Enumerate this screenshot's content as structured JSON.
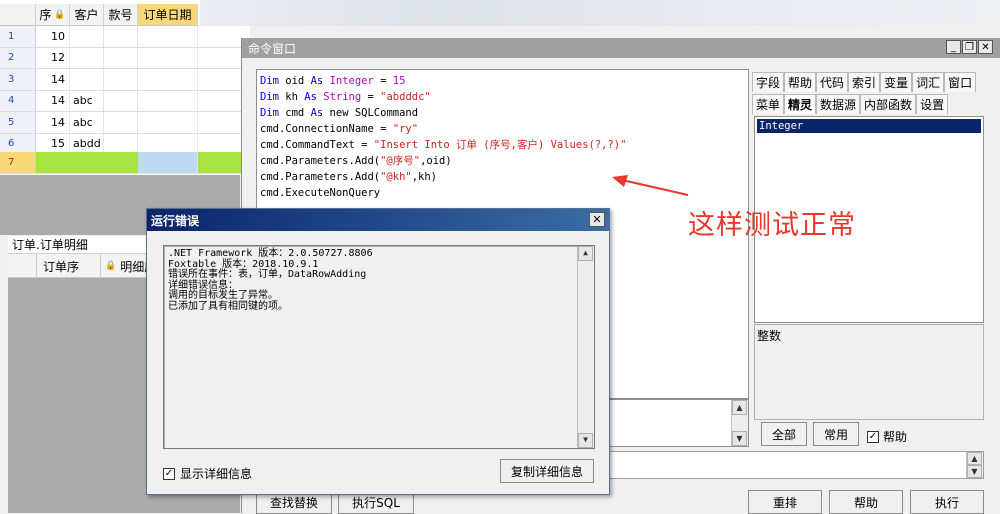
{
  "grid": {
    "columns": [
      "序",
      "客户",
      "款号",
      "订单日期"
    ],
    "rows": [
      {
        "num": "1",
        "seq": "10",
        "cust": ""
      },
      {
        "num": "2",
        "seq": "12",
        "cust": ""
      },
      {
        "num": "3",
        "seq": "14",
        "cust": ""
      },
      {
        "num": "4",
        "seq": "14",
        "cust": "abc"
      },
      {
        "num": "5",
        "seq": "14",
        "cust": "abc"
      },
      {
        "num": "6",
        "seq": "15",
        "cust": "abdd"
      },
      {
        "num": "7",
        "seq": "",
        "cust": ""
      }
    ]
  },
  "detail": {
    "title": "订单.订单明细",
    "columns": [
      "订单序",
      "明细序"
    ]
  },
  "command_window": {
    "title": "命令窗口",
    "code_lines": [
      "Dim oid As Integer = 15",
      "Dim kh As String = \"abdddc\"",
      "Dim cmd As new SQLCommand",
      "cmd.ConnectionName = \"ry\"",
      "cmd.CommandText = \"Insert Into 订单 (序号,客户) Values(?,?)\"",
      "cmd.Parameters.Add(\"@序号\",oid)",
      "cmd.Parameters.Add(\"@kh\",kh)",
      "cmd.ExecuteNonQuery"
    ],
    "tabs_row1": [
      "字段",
      "帮助",
      "代码",
      "索引",
      "变量",
      "词汇",
      "窗口"
    ],
    "tabs_row2": [
      "菜单",
      "精灵",
      "数据源",
      "内部函数",
      "设置"
    ],
    "list_selected": "Integer",
    "description": "整数",
    "btn_all": "全部",
    "btn_common": "常用",
    "chk_help": "帮助",
    "bottom_buttons": [
      "查找替换",
      "执行SQL",
      "重排",
      "帮助",
      "执行"
    ]
  },
  "annotation": "这样测试正常",
  "error_dialog": {
    "title": "运行错误",
    "lines": [
      ".NET Framework 版本：2.0.50727.8806",
      "Foxtable 版本：2018.10.9.1",
      "错误所在事件：表，订单，DataRowAdding",
      "详细错误信息：",
      "调用的目标发生了异常。",
      "已添加了具有相同键的项。"
    ],
    "show_detail_label": "显示详细信息",
    "copy_button": "复制详细信息"
  },
  "colors": {
    "accent_yellow": "#f9d87a",
    "new_row_green": "#a6e343",
    "annotation_red": "#e8382c",
    "dialog_title": "#0a246a"
  }
}
